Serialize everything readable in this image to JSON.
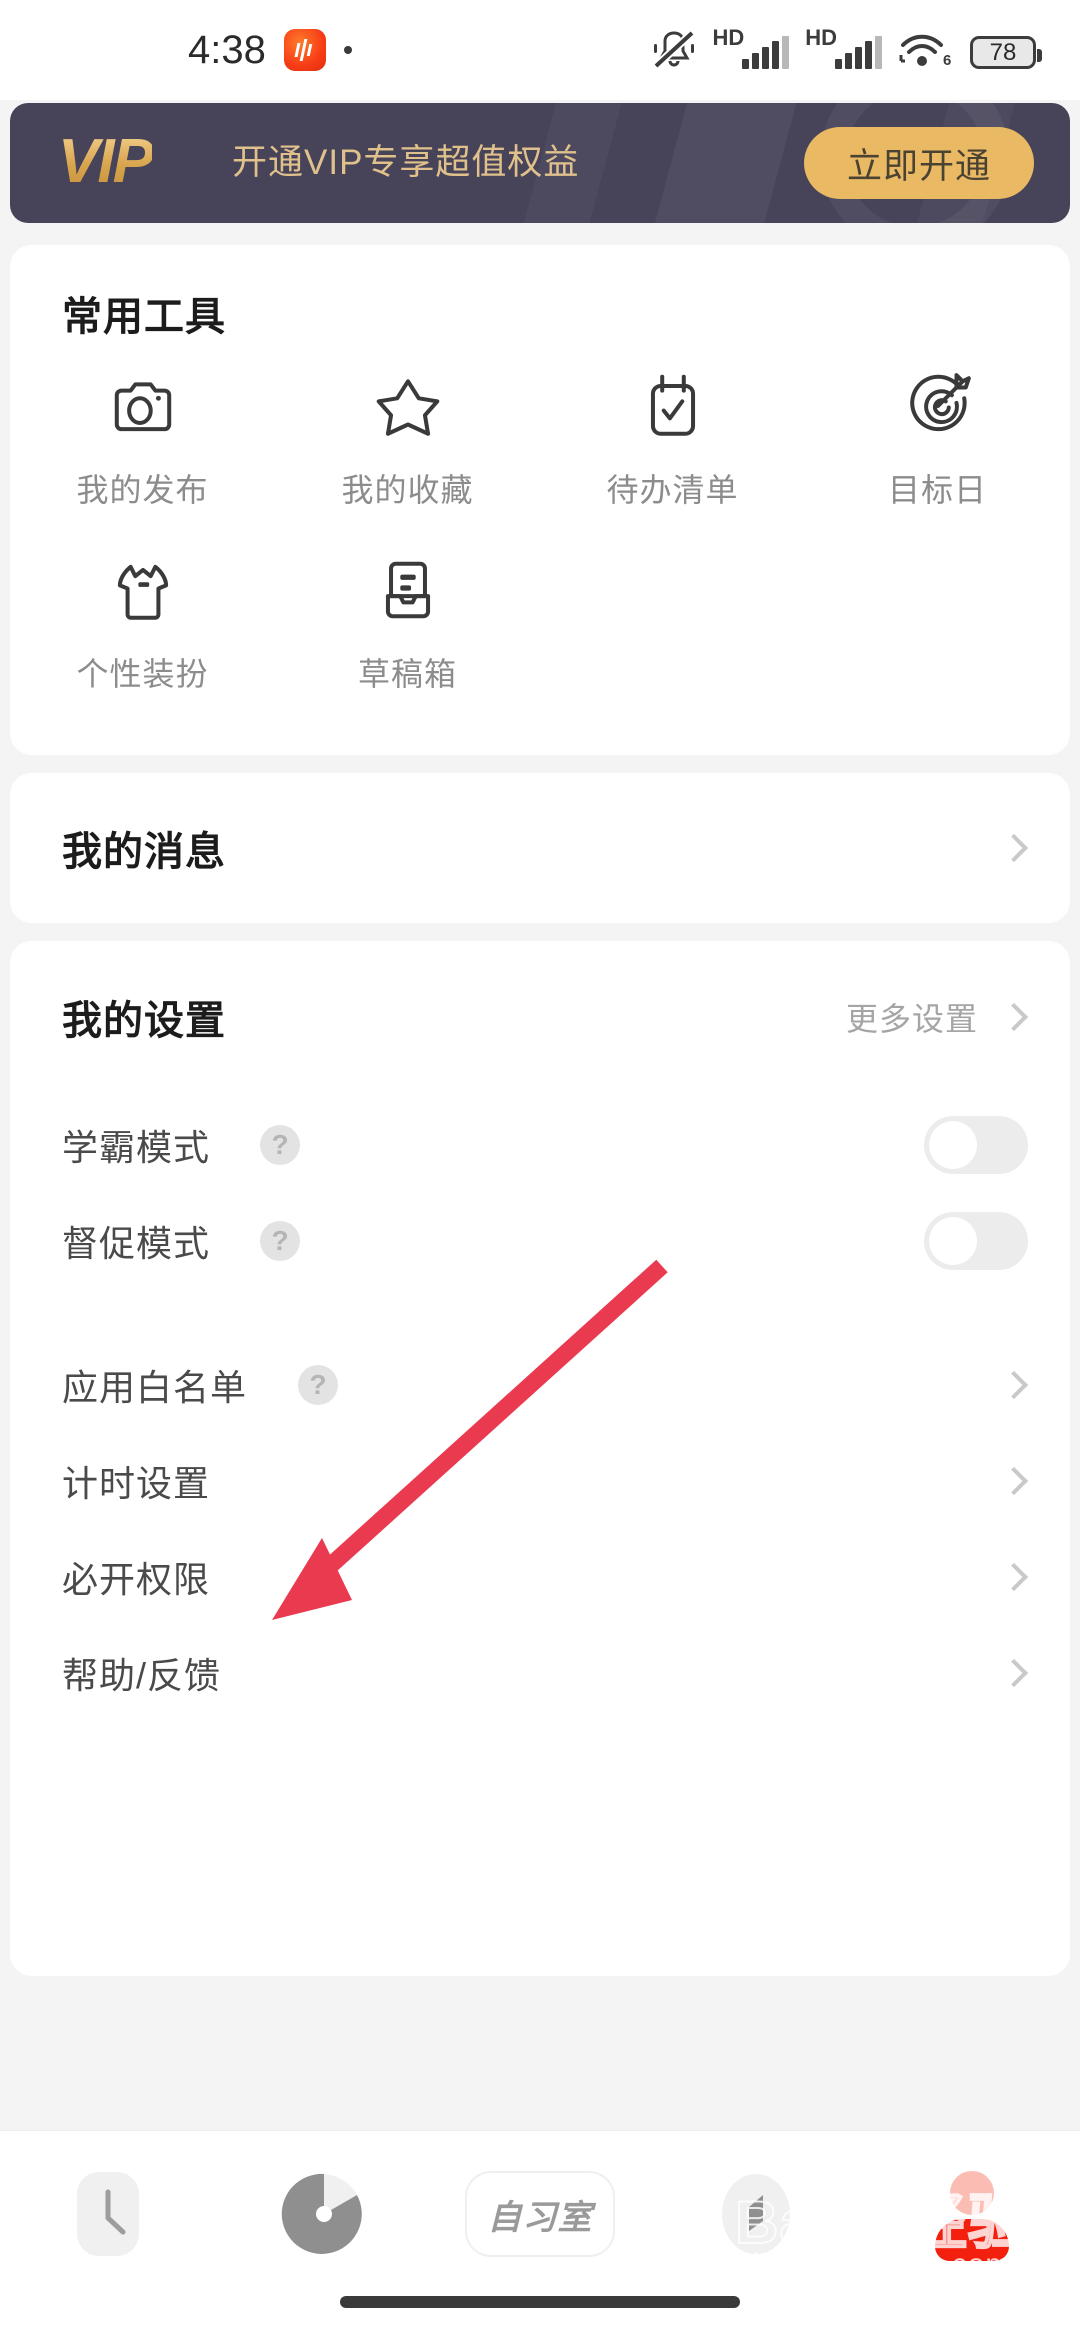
{
  "statusbar": {
    "time": "4:38",
    "app_icon": "sound-wave-app-icon",
    "mute_icon": "bell-mute-icon",
    "sim1": {
      "label": "HD",
      "icon": "signal-bars-icon"
    },
    "sim2": {
      "label": "HD",
      "icon": "signal-bars-icon"
    },
    "wifi": {
      "icon": "wifi-icon",
      "generation": "6"
    },
    "battery": {
      "level": "78",
      "icon": "battery-icon"
    }
  },
  "vip_banner": {
    "logo": "VIP",
    "text": "开通VIP专享超值权益",
    "button": "立即开通",
    "bg_color": "#474359",
    "gold_color": "#eab964"
  },
  "tools_card": {
    "title": "常用工具",
    "items": [
      {
        "label": "我的发布",
        "icon": "camera-icon"
      },
      {
        "label": "我的收藏",
        "icon": "star-icon"
      },
      {
        "label": "待办清单",
        "icon": "checklist-calendar-icon"
      },
      {
        "label": "目标日",
        "icon": "target-dart-icon"
      },
      {
        "label": "个性装扮",
        "icon": "tshirt-icon"
      },
      {
        "label": "草稿箱",
        "icon": "draft-box-icon"
      }
    ]
  },
  "messages_card": {
    "title": "我的消息",
    "chevron": "chevron-right-icon"
  },
  "settings_card": {
    "title": "我的设置",
    "more_label": "更多设置",
    "more_chevron": "chevron-right-icon",
    "rows": [
      {
        "label": "学霸模式",
        "help": "?",
        "control": "toggle",
        "state": "off"
      },
      {
        "label": "督促模式",
        "help": "?",
        "control": "toggle",
        "state": "off"
      },
      {
        "label": "应用白名单",
        "help": "?",
        "control": "chevron",
        "state": ""
      },
      {
        "label": "计时设置",
        "help": "",
        "control": "chevron",
        "state": ""
      },
      {
        "label": "必开权限",
        "help": "",
        "control": "chevron",
        "state": ""
      },
      {
        "label": "帮助/反馈",
        "help": "",
        "control": "chevron",
        "state": ""
      }
    ]
  },
  "annotation": {
    "type": "arrow",
    "color": "#ea3a4f",
    "points_to": "计时设置"
  },
  "bottom_nav": {
    "items": [
      {
        "label": "",
        "icon": "clock-icon"
      },
      {
        "label": "",
        "icon": "pie-chart-icon"
      },
      {
        "label": "自习室",
        "icon": "study-room-pill"
      },
      {
        "label": "",
        "icon": "compass-icon"
      },
      {
        "label": "",
        "icon": "profile-avatar-icon"
      }
    ]
  },
  "watermark": {
    "line1": "Baidu经验",
    "line2": "jingyan.baidu.com"
  }
}
